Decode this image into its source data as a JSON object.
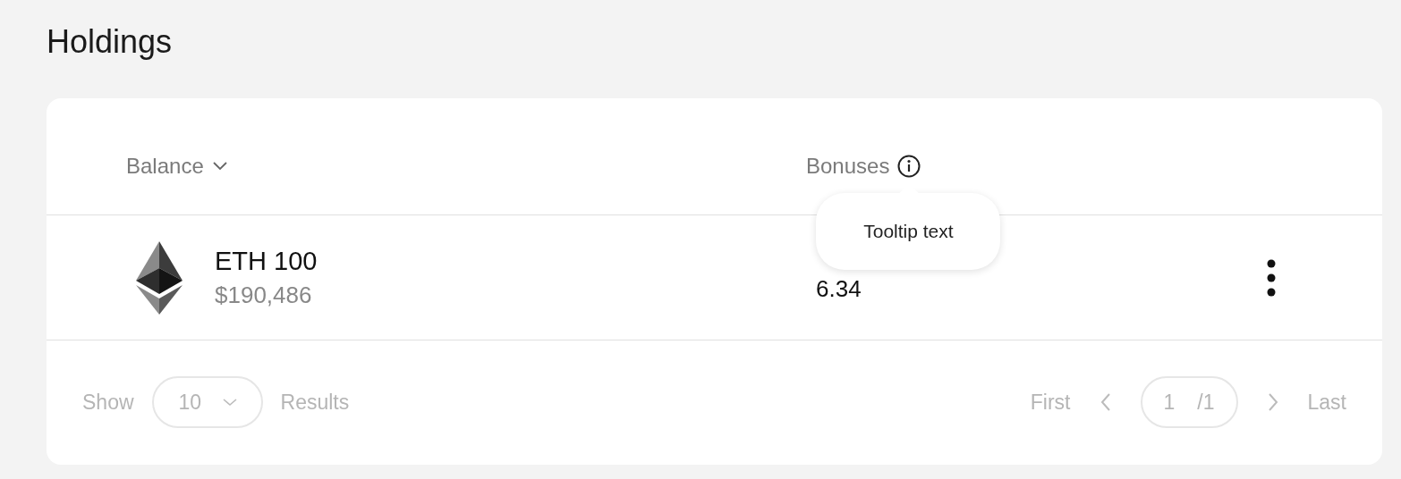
{
  "title": "Holdings",
  "table": {
    "columns": [
      {
        "label": "Balance",
        "sortable": true
      },
      {
        "label": "Bonuses",
        "info": true
      }
    ],
    "rows": [
      {
        "asset": "ETH 100",
        "value": "$190,486",
        "bonus": "6.34"
      }
    ]
  },
  "tooltip": {
    "text": "Tooltip text"
  },
  "pagination": {
    "show_label": "Show",
    "page_size": "10",
    "results_label": "Results",
    "first": "First",
    "page": "1",
    "total": "/1",
    "last": "Last"
  }
}
